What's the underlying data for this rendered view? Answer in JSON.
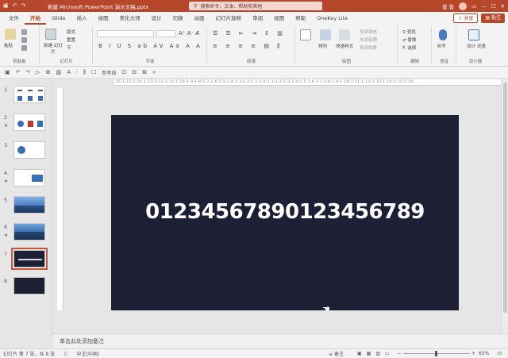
{
  "titlebar": {
    "title": "新建 Microsoft PowerPoint 演示文稿.pptx",
    "search": "搜索命令、文本、帮助和其他",
    "user": "曾 曾"
  },
  "tabs": [
    {
      "label": "文件"
    },
    {
      "label": "开始"
    },
    {
      "label": "iSlide"
    },
    {
      "label": "插入"
    },
    {
      "label": "绘图"
    },
    {
      "label": "美化大师"
    },
    {
      "label": "设计"
    },
    {
      "label": "切换"
    },
    {
      "label": "动画"
    },
    {
      "label": "幻灯片放映"
    },
    {
      "label": "审阅"
    },
    {
      "label": "视图"
    },
    {
      "label": "帮助"
    },
    {
      "label": "OneKey Lite"
    }
  ],
  "share_label": "共享",
  "comment_label": "批注",
  "ribbon": {
    "clipboard": "剪贴板",
    "paste": "粘贴",
    "slides": "幻灯片",
    "new_slide": "新建 幻灯片",
    "layout": "版式",
    "reset": "重置",
    "section": "节",
    "reuse": "重用 幻灯片",
    "font": "字体",
    "paragraph": "段落",
    "drawing": "绘图",
    "arrange": "排列",
    "quick_styles": "快速样式",
    "shape_fill": "形状填充",
    "shape_outline": "形状轮廓",
    "shape_effects": "形状效果",
    "editing": "编辑",
    "find": "查找",
    "replace": "替换",
    "select": "选择",
    "voice": "语音",
    "dictate": "听写",
    "designer": "设计器",
    "design_ideas": "设计 灵感"
  },
  "qat": {
    "guides": "参考线"
  },
  "ruler_text": "·16·1·15·1·14·1·13·1·12·1·11·1·10·1·9·1·8·1·7·1·6·1·5·1·4·1·3·1·2·1·1·1·0·1·1·1·2·1·3·1·4·1·5·1·6·1·7·1·8·1·9·1·10·1·11·1·12·1·13·1·14·1·15·1·16·",
  "thumbnails": [
    {
      "num": "1",
      "star": ""
    },
    {
      "num": "2",
      "star": "★"
    },
    {
      "num": "3",
      "star": ""
    },
    {
      "num": "4",
      "star": "★"
    },
    {
      "num": "5",
      "star": ""
    },
    {
      "num": "6",
      "star": "★"
    },
    {
      "num": "7",
      "star": ""
    },
    {
      "num": "8",
      "star": ""
    }
  ],
  "slide": {
    "text": "01234567890123456789",
    "background": "#1d2034"
  },
  "notes_placeholder": "单击此处添加备注",
  "status": {
    "slide_info": "幻灯片 第 7 张，共 8 张",
    "language": "中文(中国)",
    "notes": "备注",
    "zoom": "65%"
  },
  "colors": {
    "accent": "#b7472a",
    "slide_bg": "#1d2034"
  }
}
